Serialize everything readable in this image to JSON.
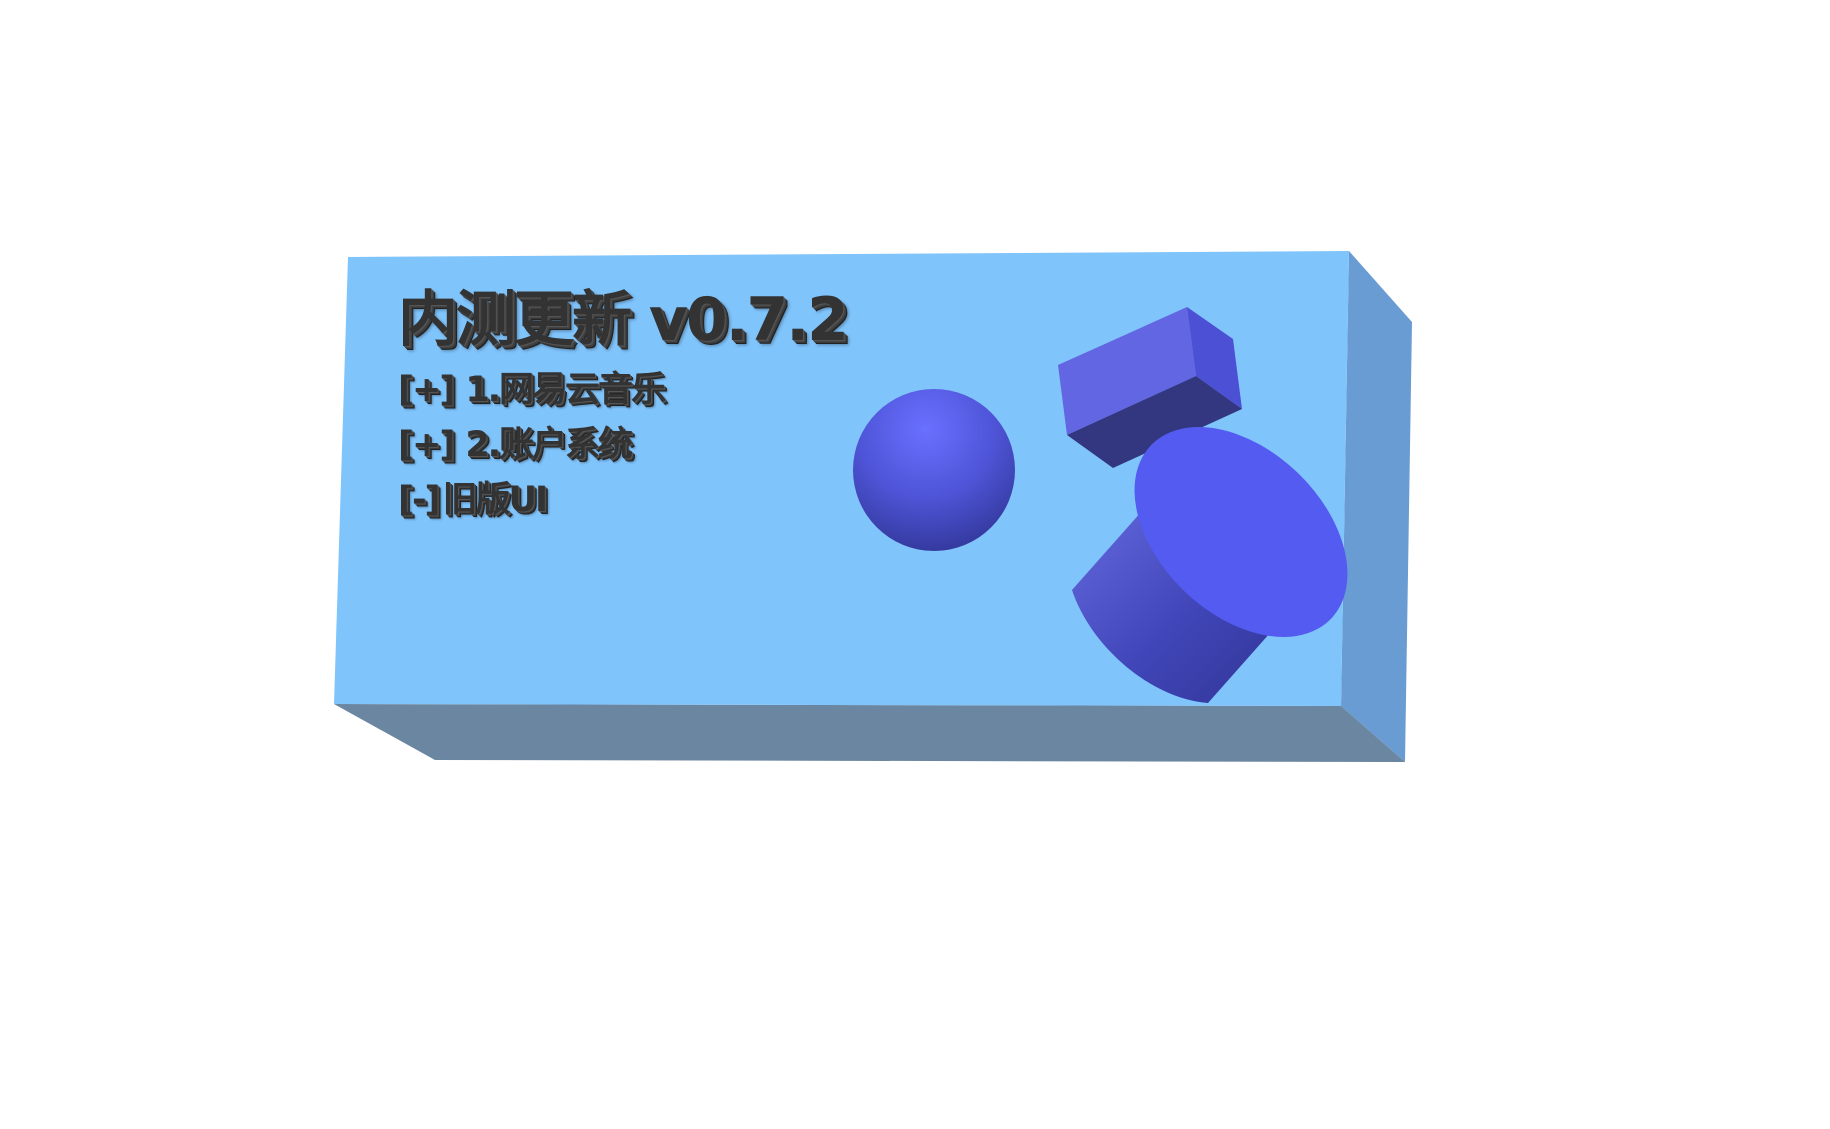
{
  "panel": {
    "title": "内测更新 v0.7.2",
    "items": [
      {
        "marker": "[+]",
        "label": "1.网易云音乐",
        "state": "expanded"
      },
      {
        "marker": "[+]",
        "label": "2.账户系统",
        "state": "expanded"
      },
      {
        "marker": "[-]",
        "label": "旧版UI",
        "state": "collapsed"
      }
    ]
  },
  "colors": {
    "background": "#ffffff",
    "panel_face": "#80c4fc",
    "panel_right_side": "#6a9cd4",
    "panel_bottom_side": "#6a86a0",
    "text": "#333333",
    "shape_highlight": "#6467f0",
    "shape_shadow": "#34378a"
  },
  "shapes": [
    "sphere",
    "box",
    "cylinder"
  ]
}
